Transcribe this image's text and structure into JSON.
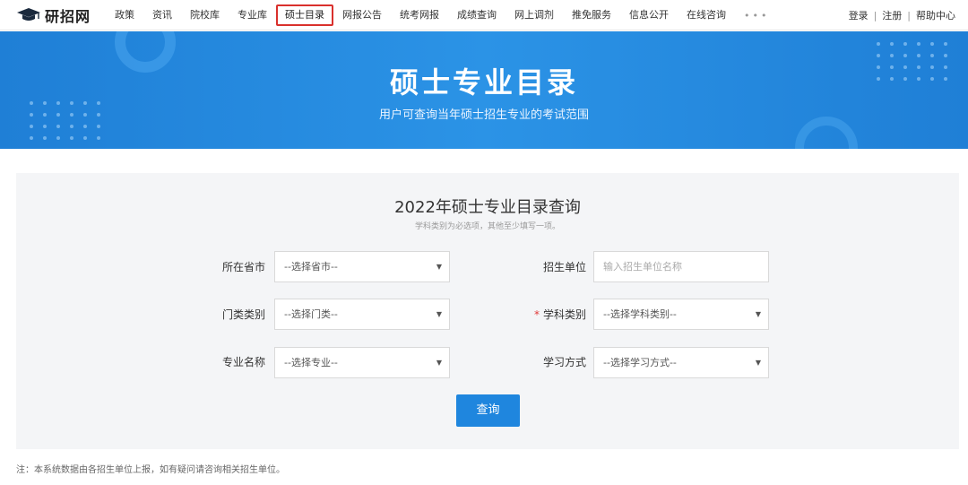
{
  "brand": {
    "name": "研招网",
    "icon": "graduation-cap-icon"
  },
  "nav": {
    "items": [
      "政策",
      "资讯",
      "院校库",
      "专业库",
      "硕士目录",
      "网报公告",
      "统考网报",
      "成绩查询",
      "网上调剂",
      "推免服务",
      "信息公开",
      "在线咨询"
    ],
    "active": "硕士目录",
    "more": "•••"
  },
  "auth": {
    "login": "登录",
    "register": "注册",
    "help": "帮助中心",
    "separator": "|"
  },
  "banner": {
    "title": "硕士专业目录",
    "subtitle": "用户可查询当年硕士招生专业的考试范围"
  },
  "form": {
    "title": "2022年硕士专业目录查询",
    "hint": "学科类别为必选项，其他至少填写一项。",
    "required_mark": "*",
    "province": {
      "label": "所在省市",
      "value": "--选择省市--"
    },
    "unit": {
      "label": "招生单位",
      "placeholder": "输入招生单位名称"
    },
    "category": {
      "label": "门类类别",
      "value": "--选择门类--"
    },
    "discipline": {
      "label": "学科类别",
      "value": "--选择学科类别--"
    },
    "major": {
      "label": "专业名称",
      "value": "--选择专业--"
    },
    "study_mode": {
      "label": "学习方式",
      "value": "--选择学习方式--"
    },
    "submit": "查询"
  },
  "note": "注：本系统数据由各招生单位上报，如有疑问请咨询相关招生单位。",
  "colors": {
    "accent": "#1f86de",
    "banner": "#2b8fe3",
    "active_border": "#d9302c",
    "required": "#e03a3a"
  }
}
